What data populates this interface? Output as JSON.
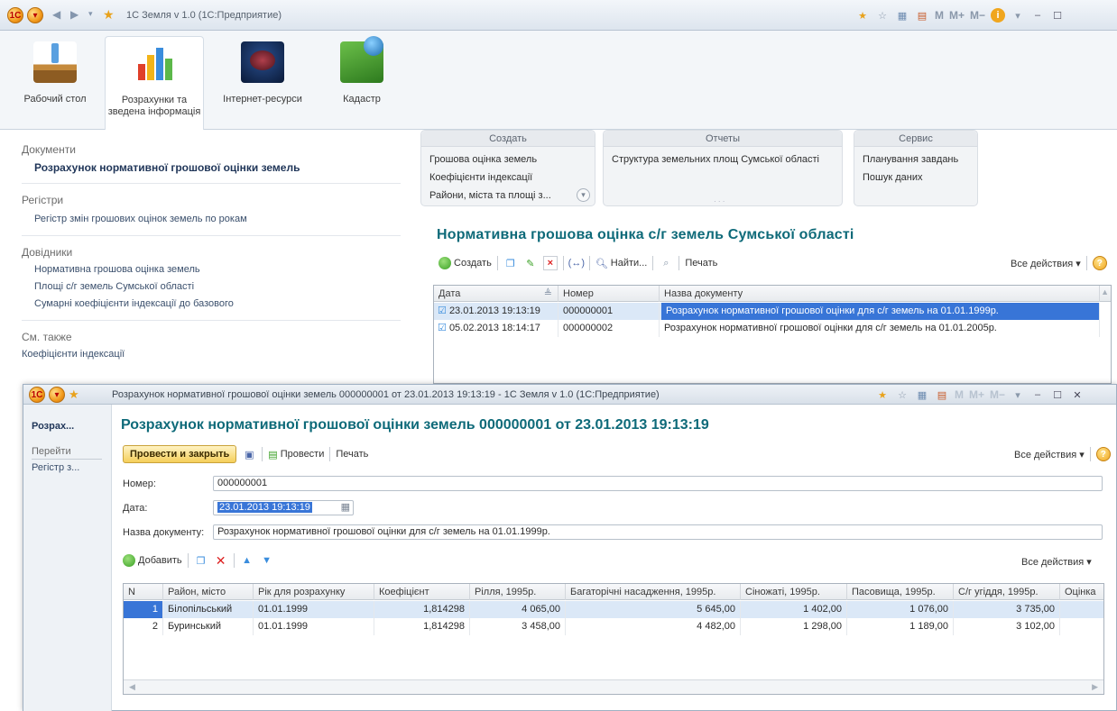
{
  "window": {
    "title": "1С Земля v 1.0 (1С:Предприятие)"
  },
  "sections": [
    {
      "label": "Рабочий стол",
      "icon": "desk-icon"
    },
    {
      "label": "Розрахунки та зведена інформація",
      "icon": "charts-icon"
    },
    {
      "label": "Інтернет-ресурси",
      "icon": "internet-icon"
    },
    {
      "label": "Кадастр",
      "icon": "cadastre-globe-icon"
    }
  ],
  "nav": {
    "documents_head": "Документи",
    "documents": [
      "Розрахунок нормативної грошової оцінки земель"
    ],
    "registers_head": "Регістри",
    "registers": [
      "Регістр змін грошових оцінок земель по рокам"
    ],
    "refs_head": "Довідники",
    "refs": [
      "Нормативна грошова оцінка земель",
      "Площі с/г земель Сумської області",
      "Сумарні коефіцієнти індексації до базового"
    ],
    "see_also_head": "См. также",
    "see_also": [
      "Коефіцієнти індексації"
    ]
  },
  "commands": {
    "create": {
      "title": "Создать",
      "items": [
        "Грошова оцінка земель",
        "Коефіцієнти індексації",
        "Райони, міста та площі з..."
      ]
    },
    "reports": {
      "title": "Отчеты",
      "items": [
        "Структура земельних площ Сумської області"
      ]
    },
    "service": {
      "title": "Сервис",
      "items": [
        "Планування завдань",
        "Пошук даних"
      ]
    }
  },
  "list": {
    "title": "Нормативна грошова оцінка с/г земель Сумської області",
    "toolbar": {
      "create": "Создать",
      "find": "Найти...",
      "print": "Печать",
      "all_actions": "Все действия ▾"
    },
    "columns": [
      "Дата",
      "Номер",
      "Назва документу"
    ],
    "rows": [
      {
        "date": "23.01.2013 19:13:19",
        "number": "000000001",
        "name": "Розрахунок нормативної грошової оцінки для с/г земель на 01.01.1999р."
      },
      {
        "date": "05.02.2013 18:14:17",
        "number": "000000002",
        "name": "Розрахунок нормативної грошової оцінки для с/г земель на 01.01.2005р."
      }
    ]
  },
  "doc": {
    "window_title": "Розрахунок нормативної грошової оцінки земель 000000001 от 23.01.2013 19:13:19 - 1С Земля v 1.0 (1С:Предприятие)",
    "nav": {
      "item1": "Розрах...",
      "goto": "Перейти",
      "item2": "Регістр з..."
    },
    "title": "Розрахунок нормативної грошової оцінки земель 000000001 от 23.01.2013 19:13:19",
    "toolbar": {
      "post_close": "Провести и закрыть",
      "post": "Провести",
      "print": "Печать",
      "all_actions": "Все действия ▾"
    },
    "fields": {
      "number_label": "Номер:",
      "number": "000000001",
      "date_label": "Дата:",
      "date": "23.01.2013 19:13:19",
      "name_label": "Назва документу:",
      "name": "Розрахунок нормативної грошової оцінки для с/г земель на 01.01.1999р."
    },
    "table_toolbar": {
      "add": "Добавить",
      "all_actions": "Все действия ▾"
    },
    "columns": [
      "N",
      "Район, місто",
      "Рік для розрахунку",
      "Коефіцієнт",
      "Рілля, 1995р.",
      "Багаторічні насадження, 1995р.",
      "Сіножаті, 1995р.",
      "Пасовища, 1995р.",
      "С/г угіддя, 1995р.",
      "Оцінка"
    ],
    "rows": [
      {
        "n": "1",
        "district": "Білопільський",
        "year": "01.01.1999",
        "coef": "1,814298",
        "arable": "4 065,00",
        "perennial": "5 645,00",
        "hay": "1 402,00",
        "pasture": "1 076,00",
        "total": "3 735,00"
      },
      {
        "n": "2",
        "district": "Буринський",
        "year": "01.01.1999",
        "coef": "1,814298",
        "arable": "3 458,00",
        "perennial": "4 482,00",
        "hay": "1 298,00",
        "pasture": "1 189,00",
        "total": "3 102,00"
      }
    ]
  },
  "colors": {
    "title_teal": "#0e6a79",
    "selection": "#3875d7",
    "row_selected": "#dbe8f7"
  }
}
